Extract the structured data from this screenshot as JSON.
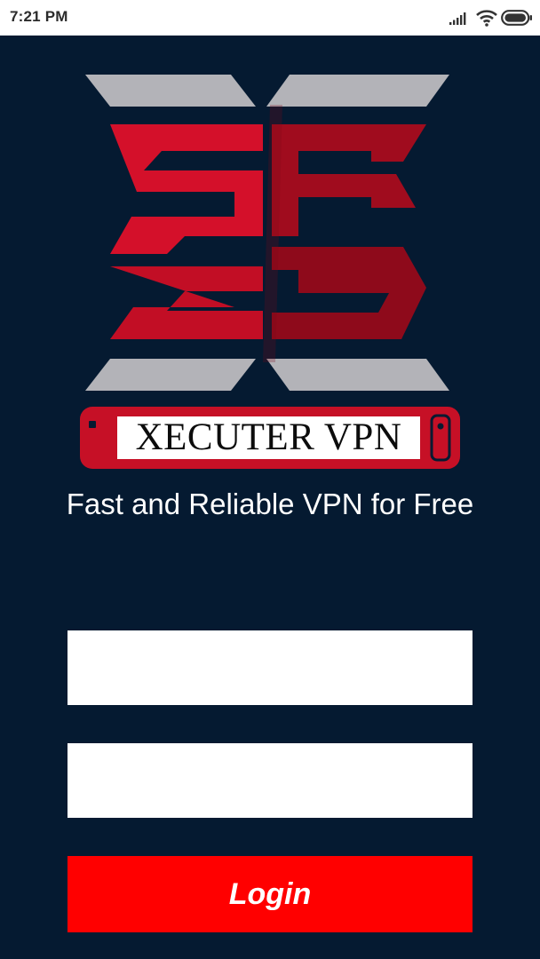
{
  "status_bar": {
    "time": "7:21 PM",
    "icons": [
      "signal-icon",
      "wifi-icon",
      "battery-icon"
    ]
  },
  "branding": {
    "logo_icon": "xecuter-logo-icon",
    "name": "XECUTER VPN",
    "tagline": "Fast and Reliable VPN for Free"
  },
  "form": {
    "username": {
      "value": "",
      "placeholder": ""
    },
    "password": {
      "value": "",
      "placeholder": ""
    },
    "login_label": "Login"
  },
  "colors": {
    "background": "#051a31",
    "status_bar": "#ffffff",
    "logo_red": "#d4102a",
    "logo_dark_red": "#a00c1e",
    "logo_silver": "#b3b3b8",
    "button": "#ff0000",
    "text": "#ffffff"
  }
}
